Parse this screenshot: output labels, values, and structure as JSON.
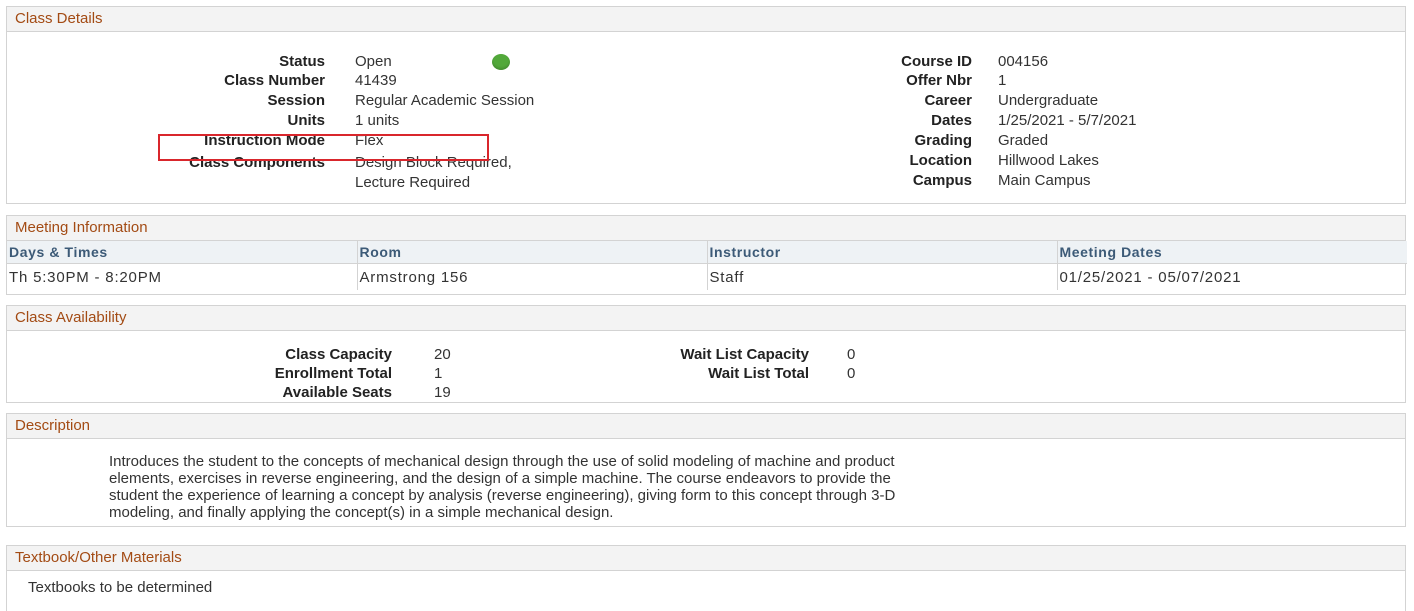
{
  "class_details": {
    "header": "Class Details",
    "left": [
      {
        "label": "Status",
        "value": "Open"
      },
      {
        "label": "Class Number",
        "value": "41439"
      },
      {
        "label": "Session",
        "value": "Regular Academic Session"
      },
      {
        "label": "Units",
        "value": "1 units"
      },
      {
        "label": "Instruction Mode",
        "value": "Flex"
      },
      {
        "label": "Class Components",
        "value": "Design Block Required,",
        "value2": "Lecture Required"
      }
    ],
    "right": [
      {
        "label": "Course ID",
        "value": "004156"
      },
      {
        "label": "Offer Nbr",
        "value": "1"
      },
      {
        "label": "Career",
        "value": "Undergraduate"
      },
      {
        "label": "Dates",
        "value": "1/25/2021 - 5/7/2021"
      },
      {
        "label": "Grading",
        "value": "Graded"
      },
      {
        "label": "Location",
        "value": "Hillwood Lakes"
      },
      {
        "label": "Campus",
        "value": "Main Campus"
      }
    ],
    "status_color": "#52a83a",
    "highlight_color": "#d9262c"
  },
  "meeting": {
    "header": "Meeting Information",
    "columns": [
      "Days & Times",
      "Room",
      "Instructor",
      "Meeting Dates"
    ],
    "rows": [
      [
        "Th 5:30PM - 8:20PM",
        "Armstrong 156",
        "Staff",
        "01/25/2021 - 05/07/2021"
      ]
    ]
  },
  "availability": {
    "header": "Class Availability",
    "left": [
      {
        "label": "Class Capacity",
        "value": "20"
      },
      {
        "label": "Enrollment Total",
        "value": "1"
      },
      {
        "label": "Available Seats",
        "value": "19"
      }
    ],
    "right": [
      {
        "label": "Wait List Capacity",
        "value": "0"
      },
      {
        "label": "Wait List Total",
        "value": "0"
      }
    ]
  },
  "description": {
    "header": "Description",
    "lines": [
      "Introduces the student to the concepts of mechanical design through the use of solid modeling of machine and product",
      "elements, exercises in reverse engineering, and the design of a simple machine.  The course endeavors to provide the",
      "student the experience of learning a concept by analysis (reverse engineering), giving form to this concept through 3-D",
      "modeling, and finally applying the concept(s) in a simple mechanical design."
    ]
  },
  "textbook": {
    "header": "Textbook/Other Materials",
    "text": "Textbooks to be determined"
  },
  "colors": {
    "section_header_text": "#a34b14",
    "table_header_text": "#3c5a77"
  }
}
